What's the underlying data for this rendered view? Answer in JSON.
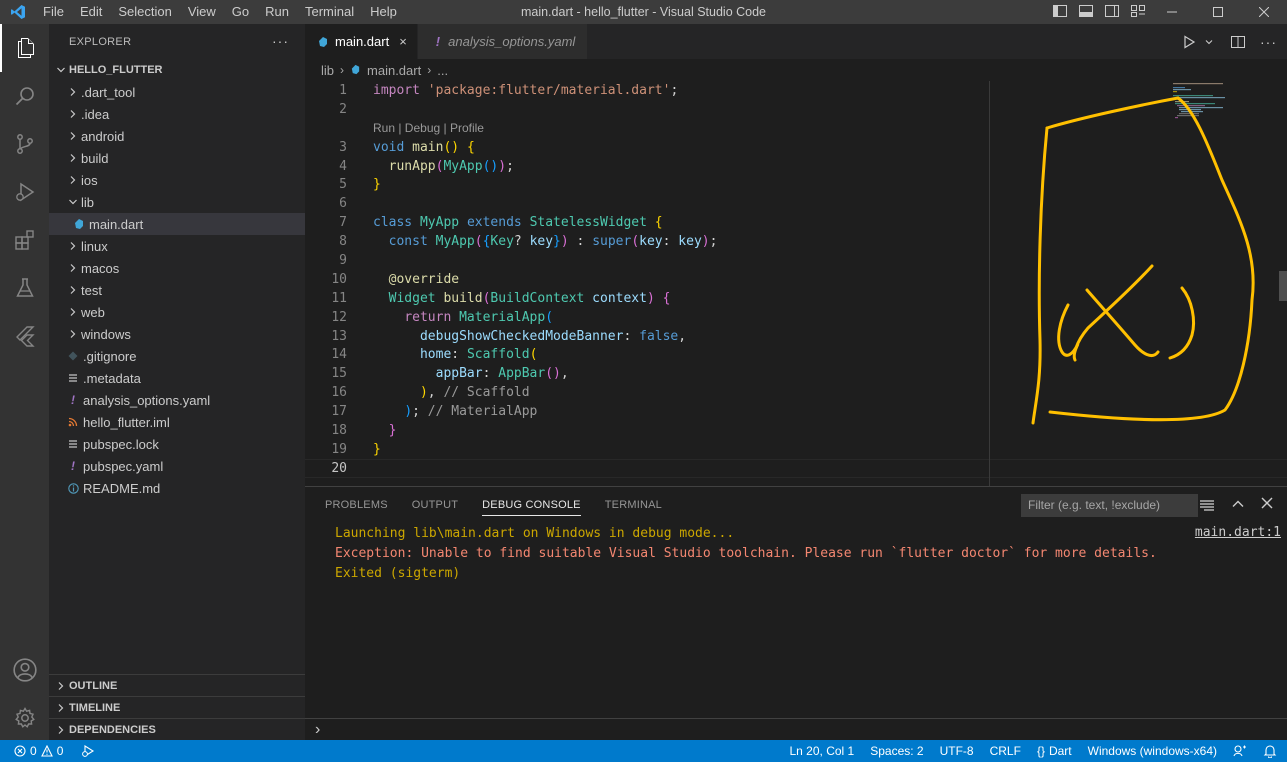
{
  "window": {
    "title": "main.dart - hello_flutter - Visual Studio Code",
    "menu": [
      "File",
      "Edit",
      "Selection",
      "View",
      "Go",
      "Run",
      "Terminal",
      "Help"
    ]
  },
  "sidebar": {
    "header": "EXPLORER",
    "more": "···",
    "root": "HELLO_FLUTTER",
    "items": [
      {
        "label": ".dart_tool",
        "type": "folder"
      },
      {
        "label": ".idea",
        "type": "folder"
      },
      {
        "label": "android",
        "type": "folder"
      },
      {
        "label": "build",
        "type": "folder"
      },
      {
        "label": "ios",
        "type": "folder"
      },
      {
        "label": "lib",
        "type": "folder-open"
      },
      {
        "label": "main.dart",
        "type": "dart"
      },
      {
        "label": "linux",
        "type": "folder"
      },
      {
        "label": "macos",
        "type": "folder"
      },
      {
        "label": "test",
        "type": "folder"
      },
      {
        "label": "web",
        "type": "folder"
      },
      {
        "label": "windows",
        "type": "folder"
      },
      {
        "label": ".gitignore",
        "type": "git"
      },
      {
        "label": ".metadata",
        "type": "lines"
      },
      {
        "label": "analysis_options.yaml",
        "type": "yaml"
      },
      {
        "label": "hello_flutter.iml",
        "type": "rss"
      },
      {
        "label": "pubspec.lock",
        "type": "lines"
      },
      {
        "label": "pubspec.yaml",
        "type": "yaml"
      },
      {
        "label": "README.md",
        "type": "info"
      }
    ],
    "sections": [
      "OUTLINE",
      "TIMELINE",
      "DEPENDENCIES"
    ]
  },
  "tabs": [
    {
      "label": "main.dart",
      "close": "×"
    },
    {
      "label": "analysis_options.yaml"
    }
  ],
  "breadcrumb": [
    "lib",
    "main.dart",
    "..."
  ],
  "editor": {
    "codelens": "Run | Debug | Profile",
    "line_numbers": [
      "1",
      "2",
      "3",
      "4",
      "5",
      "6",
      "7",
      "8",
      "9",
      "10",
      "11",
      "12",
      "13",
      "14",
      "15",
      "16",
      "17",
      "18",
      "19",
      "20"
    ],
    "lines": {
      "l1": {
        "a": "import",
        "b": "'package:flutter/material.dart'",
        "c": ";"
      },
      "l3": {
        "a": "void",
        "b": "main",
        "c": "()",
        "d": "{"
      },
      "l4": {
        "a": "runApp",
        "b": "(",
        "c": "MyApp",
        "d": "()",
        "e": ")",
        "f": ";"
      },
      "l5": {
        "a": "}"
      },
      "l7": {
        "a": "class",
        "b": "MyApp",
        "c": "extends",
        "d": "StatelessWidget",
        "e": "{"
      },
      "l8": {
        "a": "const",
        "b": "MyApp",
        "c": "(",
        "d": "{",
        "e": "Key",
        "f": "?",
        "g": "key",
        "h": "}",
        "i": ")",
        "j": " : ",
        "k": "super",
        "l": "(",
        "m": "key",
        "n": ": ",
        "o": "key",
        "p": ")",
        "q": ";"
      },
      "l10": {
        "a": "@override"
      },
      "l11": {
        "a": "Widget",
        "b": "build",
        "c": "(",
        "d": "BuildContext",
        "e": "context",
        "f": ")",
        "g": "{"
      },
      "l12": {
        "a": "return",
        "b": "MaterialApp",
        "c": "("
      },
      "l13": {
        "a": "debugShowCheckedModeBanner",
        "b": ": ",
        "c": "false",
        "d": ","
      },
      "l14": {
        "a": "home",
        "b": ": ",
        "c": "Scaffold",
        "d": "("
      },
      "l15": {
        "a": "appBar",
        "b": ": ",
        "c": "AppBar",
        "d": "()",
        "e": ","
      },
      "l16": {
        "a": ")",
        "b": ", ",
        "c": "// Scaffold"
      },
      "l17": {
        "a": ")",
        "b": "; ",
        "c": "// MaterialApp"
      },
      "l18": {
        "a": "}"
      },
      "l19": {
        "a": "}"
      }
    }
  },
  "panel": {
    "tabs": [
      "PROBLEMS",
      "OUTPUT",
      "DEBUG CONSOLE",
      "TERMINAL"
    ],
    "filter_placeholder": "Filter (e.g. text, !exclude)",
    "console": [
      "Launching lib\\main.dart on Windows in debug mode...",
      "Exception: Unable to find suitable Visual Studio toolchain. Please run `flutter doctor` for more details.",
      "Exited (sigterm)"
    ],
    "link": "main.dart:1",
    "prompt": "›"
  },
  "status": {
    "errors": "0",
    "warnings": "0",
    "position": "Ln 20, Col 1",
    "spaces": "Spaces: 2",
    "encoding": "UTF-8",
    "eol": "CRLF",
    "language": "Dart",
    "device": "Windows (windows-x64)"
  },
  "colors": {
    "accent": "#007acc",
    "drawing": "#ffc000"
  }
}
